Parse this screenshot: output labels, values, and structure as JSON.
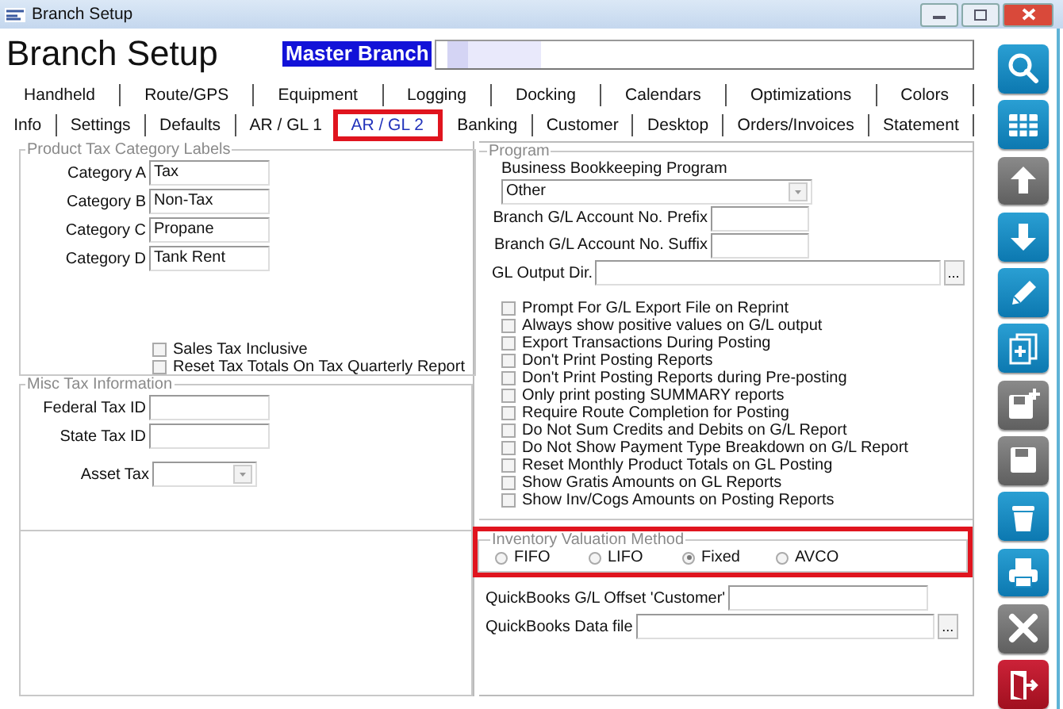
{
  "window": {
    "title": "Branch Setup"
  },
  "header": {
    "title": "Branch Setup",
    "branch": "Master Branch"
  },
  "tab_rows": [
    {
      "tabs": [
        {
          "label": "Handheld",
          "selected": false,
          "highlighted": false
        },
        {
          "label": "Route/GPS",
          "selected": false,
          "highlighted": false
        },
        {
          "label": "Equipment",
          "selected": false,
          "highlighted": false
        },
        {
          "label": "Logging",
          "selected": false,
          "highlighted": false
        },
        {
          "label": "Docking",
          "selected": false,
          "highlighted": false
        },
        {
          "label": "Calendars",
          "selected": false,
          "highlighted": false
        },
        {
          "label": "Optimizations",
          "selected": false,
          "highlighted": false
        },
        {
          "label": "Colors",
          "selected": false,
          "highlighted": false
        }
      ]
    },
    {
      "tabs": [
        {
          "label": "Info",
          "selected": false,
          "highlighted": false
        },
        {
          "label": "Settings",
          "selected": false,
          "highlighted": false
        },
        {
          "label": "Defaults",
          "selected": false,
          "highlighted": false
        },
        {
          "label": "AR / GL 1",
          "selected": false,
          "highlighted": false
        },
        {
          "label": "AR / GL 2",
          "selected": true,
          "highlighted": true
        },
        {
          "label": "Banking",
          "selected": false,
          "highlighted": false
        },
        {
          "label": "Customer",
          "selected": false,
          "highlighted": false
        },
        {
          "label": "Desktop",
          "selected": false,
          "highlighted": false
        },
        {
          "label": "Orders/Invoices",
          "selected": false,
          "highlighted": false
        },
        {
          "label": "Statement",
          "selected": false,
          "highlighted": false
        }
      ]
    }
  ],
  "tax_labels": {
    "title": "Product Tax Category Labels",
    "fields": [
      {
        "label": "Category A",
        "value": "Tax"
      },
      {
        "label": "Category B",
        "value": "Non-Tax"
      },
      {
        "label": "Category C",
        "value": "Propane"
      },
      {
        "label": "Category D",
        "value": "Tank Rent"
      }
    ],
    "checks": [
      {
        "label": "Sales Tax Inclusive",
        "checked": false
      },
      {
        "label": "Reset Tax Totals On Tax Quarterly Report",
        "checked": false
      }
    ]
  },
  "misc_tax": {
    "title": "Misc Tax Information",
    "fields": [
      {
        "label": "Federal Tax ID"
      },
      {
        "label": "State Tax ID"
      }
    ],
    "asset_tax": {
      "label": "Asset Tax"
    }
  },
  "program": {
    "title": "Program",
    "bookkeeping": {
      "label": "Business Bookkeeping Program",
      "value": "Other"
    },
    "prefix": {
      "label": "Branch G/L Account No. Prefix"
    },
    "suffix": {
      "label": "Branch G/L Account No. Suffix"
    },
    "output_dir": {
      "label": "GL Output Dir.",
      "browse": "..."
    },
    "checks": [
      {
        "label": "Prompt For G/L Export File on Reprint",
        "checked": false
      },
      {
        "label": "Always show positive values on G/L output",
        "checked": false
      },
      {
        "label": "Export Transactions During Posting",
        "checked": false
      },
      {
        "label": "Don't Print Posting Reports",
        "checked": false
      },
      {
        "label": "Don't Print Posting Reports during Pre-posting",
        "checked": false
      },
      {
        "label": "Only print posting SUMMARY reports",
        "checked": false
      },
      {
        "label": "Require Route Completion for Posting",
        "checked": false
      },
      {
        "label": "Do Not Sum Credits and Debits on G/L Report",
        "checked": false
      },
      {
        "label": "Do Not Show Payment Type Breakdown on G/L Report",
        "checked": false
      },
      {
        "label": "Reset Monthly Product Totals on GL Posting",
        "checked": false
      },
      {
        "label": "Show Gratis Amounts on GL Reports",
        "checked": false
      },
      {
        "label": "Show Inv/Cogs Amounts on Posting Reports",
        "checked": false
      }
    ]
  },
  "valuation": {
    "title": "Inventory Valuation Method",
    "highlighted": true,
    "options": [
      {
        "label": "FIFO",
        "selected": false
      },
      {
        "label": "LIFO",
        "selected": false
      },
      {
        "label": "Fixed",
        "selected": true
      },
      {
        "label": "AVCO",
        "selected": false
      }
    ]
  },
  "quickbooks": {
    "offset": {
      "label": "QuickBooks G/L Offset 'Customer'"
    },
    "data_file": {
      "label": "QuickBooks Data file",
      "browse": "..."
    }
  },
  "toolbar": [
    {
      "kind": "search",
      "disabled": false
    },
    {
      "kind": "grid",
      "disabled": false
    },
    {
      "kind": "up",
      "disabled": true
    },
    {
      "kind": "down",
      "disabled": false
    },
    {
      "kind": "edit",
      "disabled": false
    },
    {
      "kind": "new",
      "disabled": false
    },
    {
      "kind": "save-new",
      "disabled": true
    },
    {
      "kind": "save",
      "disabled": true
    },
    {
      "kind": "delete",
      "disabled": false
    },
    {
      "kind": "print",
      "disabled": false
    },
    {
      "kind": "cancel",
      "disabled": true
    },
    {
      "kind": "exit",
      "disabled": false
    }
  ]
}
